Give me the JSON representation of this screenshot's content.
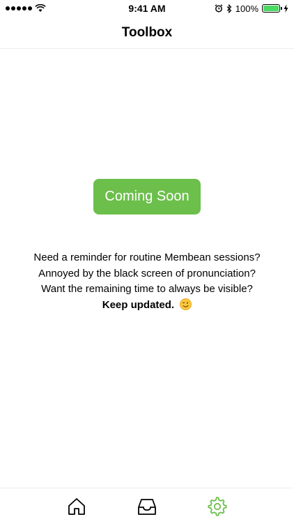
{
  "status": {
    "time": "9:41 AM",
    "battery": "100%"
  },
  "nav": {
    "title": "Toolbox"
  },
  "main": {
    "button_label": "Coming Soon",
    "lines": [
      "Need a reminder for routine Membean sessions?",
      "Annoyed by the black screen of pronunciation?",
      "Want the remaining time to always be visible?"
    ],
    "emphasis": "Keep updated."
  },
  "tabbar": {
    "items": [
      {
        "icon": "home-icon",
        "active": false
      },
      {
        "icon": "inbox-icon",
        "active": false
      },
      {
        "icon": "gear-icon",
        "active": true
      }
    ],
    "active_color": "#6cbf4b"
  }
}
